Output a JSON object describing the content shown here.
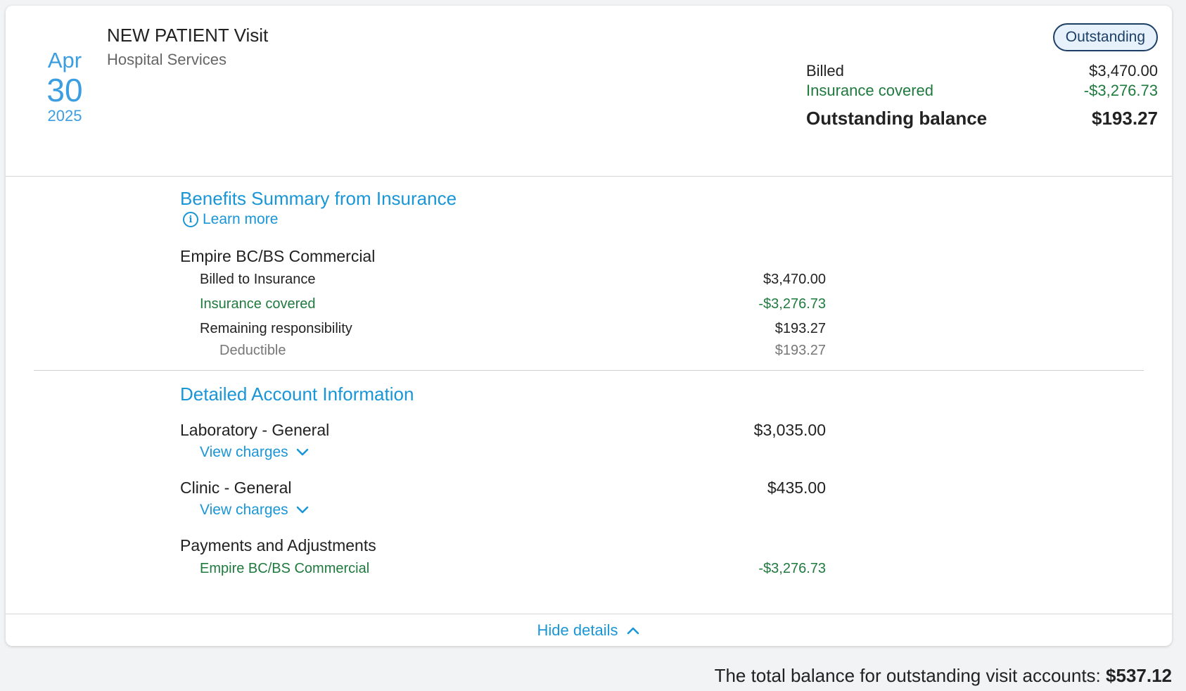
{
  "visit": {
    "date": {
      "month": "Apr",
      "day": "30",
      "year": "2025"
    },
    "title": "NEW PATIENT Visit",
    "subtitle": "Hospital Services",
    "status_badge": "Outstanding",
    "summary": {
      "billed_label": "Billed",
      "billed_value": "$3,470.00",
      "insurance_label": "Insurance covered",
      "insurance_value": "-$3,276.73",
      "balance_label": "Outstanding balance",
      "balance_value": "$193.27"
    }
  },
  "benefits": {
    "title": "Benefits Summary from Insurance",
    "learn_more": "Learn more",
    "insurer": "Empire BC/BS Commercial",
    "rows": [
      {
        "label": "Billed to Insurance",
        "value": "$3,470.00"
      },
      {
        "label": "Insurance covered",
        "value": "-$3,276.73"
      },
      {
        "label": "Remaining responsibility",
        "value": "$193.27"
      },
      {
        "label": "Deductible",
        "value": "$193.27"
      }
    ]
  },
  "account": {
    "title": "Detailed Account Information",
    "items": [
      {
        "label": "Laboratory - General",
        "value": "$3,035.00",
        "link": "View charges"
      },
      {
        "label": "Clinic - General",
        "value": "$435.00",
        "link": "View charges"
      }
    ],
    "payments_label": "Payments and Adjustments",
    "payments": [
      {
        "label": "Empire BC/BS Commercial",
        "value": "-$3,276.73"
      }
    ]
  },
  "hide_details": "Hide details",
  "total": {
    "label": "The total balance for outstanding visit accounts:",
    "value": "$537.12"
  },
  "colors": {
    "accent": "#1a96d6",
    "date": "#3a9ee0",
    "green": "#1f7a3e",
    "badge_border": "#1d3f66",
    "badge_bg": "#e6f1fb"
  },
  "icons": {
    "info": "info-circle-icon",
    "chevron_down": "chevron-down-icon",
    "chevron_up": "chevron-up-icon"
  }
}
